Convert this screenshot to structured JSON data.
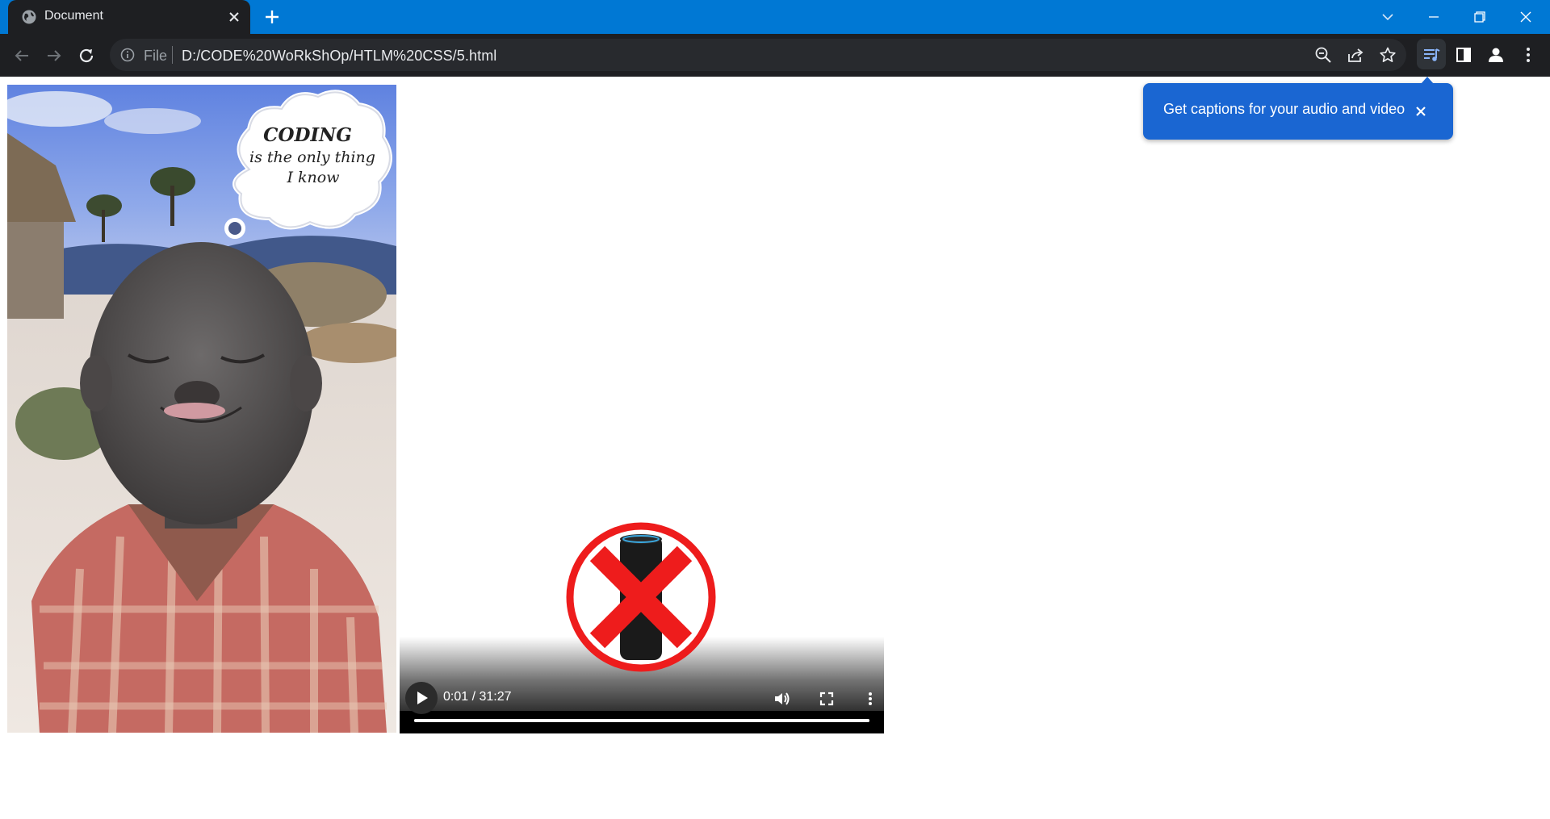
{
  "browser": {
    "tab": {
      "title": "Document",
      "favicon": "globe-icon",
      "close_icon": "close-icon"
    },
    "new_tab_icon": "plus-icon",
    "window_controls": [
      "chevron-down-icon",
      "minimize-icon",
      "restore-icon",
      "close-icon"
    ],
    "nav": [
      "back-icon",
      "forward-icon",
      "reload-icon"
    ],
    "omnibox": {
      "info_icon": "info-icon",
      "scheme": "File",
      "url": "D:/CODE%20WoRkShOp/HTLM%20CSS/5.html",
      "actions": [
        "zoom-out-icon",
        "share-icon",
        "star-icon"
      ]
    },
    "toolbar_icons": [
      "reading-list-icon",
      "side-panel-icon",
      "profile-icon",
      "more-vert-icon"
    ]
  },
  "captions_popup": {
    "text": "Get captions for your audio and video",
    "close_icon": "close-icon"
  },
  "page": {
    "meme": {
      "line1": "CODING",
      "line2": "is the only thing",
      "line3": "I know"
    },
    "video": {
      "current_time": "0:01",
      "duration": "31:27",
      "time_display": "0:01 / 31:27",
      "progress": 0.0005,
      "controls": [
        "play-icon",
        "volume-icon",
        "fullscreen-icon",
        "more-vert-icon"
      ],
      "poster": "speaker-crossed-out"
    }
  },
  "colors": {
    "titlebar": "#0078d4",
    "toolbar": "#1e1f22",
    "omnibox": "#282a2e",
    "popup": "#1a66d2",
    "reading_list_active": "#8ab4f8",
    "red_x": "#ee1c1c"
  }
}
